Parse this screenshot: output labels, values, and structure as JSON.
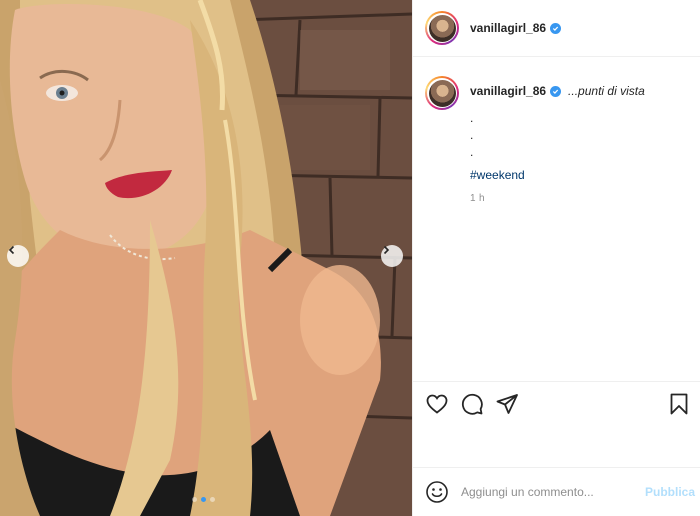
{
  "post": {
    "username": "vanillagirl_86",
    "caption": "...punti di vista",
    "caption_dots": ".\n.\n.",
    "hashtag": "#weekend",
    "time": "1 h"
  },
  "media": {
    "slide_count": 3,
    "active_slide": 2
  },
  "icons": {
    "verified": "verified-badge-icon",
    "like": "heart-icon",
    "comment": "comment-bubble-icon",
    "share": "paper-plane-icon",
    "save": "bookmark-icon",
    "emoji": "smiley-icon",
    "prev": "chevron-left-icon",
    "next": "chevron-right-icon"
  },
  "comment_box": {
    "placeholder": "Aggiungi un commento...",
    "publish_label": "Pubblica"
  },
  "colors": {
    "verified": "#3897f0",
    "hashtag": "#00376b",
    "publish_disabled": "#b2dffc",
    "muted": "#8e8e8e"
  }
}
